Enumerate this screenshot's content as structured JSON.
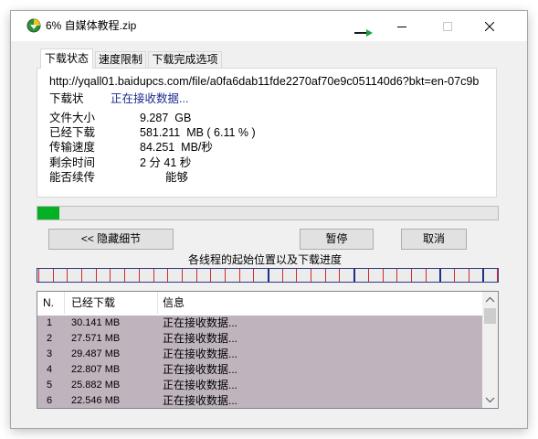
{
  "window": {
    "title": "6% 自媒体教程.zip",
    "icons": {
      "app": "idm-app-icon",
      "tray": "send-to-tray-arrow-icon",
      "minimize": "minimize-icon",
      "maximize": "maximize-icon",
      "close": "close-icon"
    }
  },
  "tabs": [
    {
      "label": "下载状态",
      "selected": true
    },
    {
      "label": "速度限制",
      "selected": false
    },
    {
      "label": "下载完成选项",
      "selected": false
    }
  ],
  "status": {
    "url": "http://yqall01.baidupcs.com/file/a0fa6dab11fde2270af70e9c051140d6?bkt=en-07c9b",
    "state_label": "下载状",
    "state_value": "正在接收数据...",
    "fields": [
      {
        "label": "文件大小",
        "value": "9.287  GB"
      },
      {
        "label": "已经下载",
        "value": "581.211  MB ( 6.11 % )"
      },
      {
        "label": "传输速度",
        "value": "84.251  MB/秒"
      },
      {
        "label": "剩余时间",
        "value": "2 分 41 秒"
      },
      {
        "label": "能否续传",
        "value": "能够"
      }
    ]
  },
  "progress": {
    "fill_percent": 4.7
  },
  "buttons": {
    "hide_details": "<< 隐藏细节",
    "pause": "暂停",
    "cancel": "取消"
  },
  "threads": {
    "caption": "各线程的起始位置以及下载进度"
  },
  "connections": {
    "columns": [
      "N.",
      "已经下载",
      "信息"
    ],
    "rows": [
      {
        "n": "1",
        "downloaded": "30.141 MB",
        "info": "正在接收数据..."
      },
      {
        "n": "2",
        "downloaded": "27.571 MB",
        "info": "正在接收数据..."
      },
      {
        "n": "3",
        "downloaded": "29.487 MB",
        "info": "正在接收数据..."
      },
      {
        "n": "4",
        "downloaded": "22.807 MB",
        "info": "正在接收数据..."
      },
      {
        "n": "5",
        "downloaded": "25.882 MB",
        "info": "正在接收数据..."
      },
      {
        "n": "6",
        "downloaded": "22.546 MB",
        "info": "正在接收数据..."
      }
    ]
  },
  "colors": {
    "progress_fill": "#06b025",
    "status_text": "#1b2c8c",
    "row_background": "#bfb4be",
    "thread_start_marker": "#d42a2a",
    "thread_progress_marker": "#1e2f86"
  }
}
